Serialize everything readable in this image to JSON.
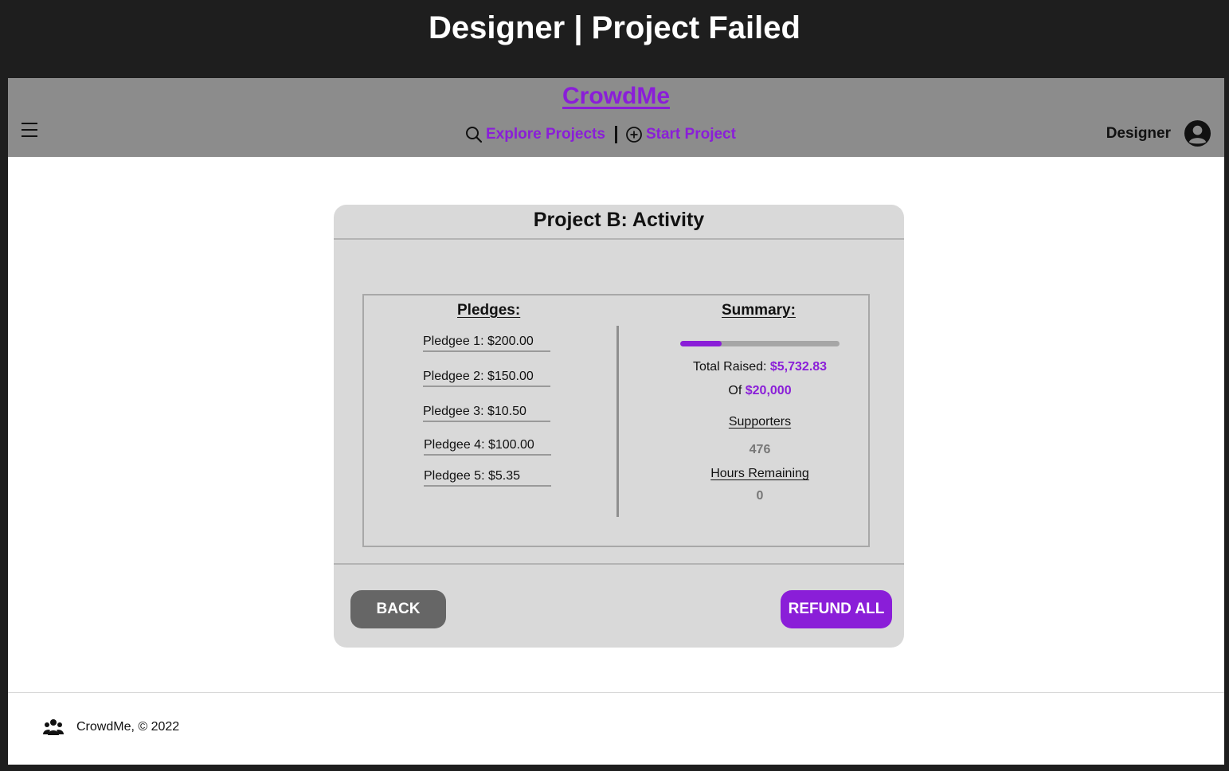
{
  "frame": {
    "title": "Designer | Project Failed"
  },
  "navbar": {
    "brand": "CrowdMe",
    "links": [
      {
        "label": "Explore Projects",
        "icon": "search-icon"
      },
      {
        "label": "Start Project",
        "icon": "plus-circle-icon"
      }
    ],
    "user": {
      "name": "Designer",
      "icon": "user-avatar-icon"
    },
    "menu_icon": "hamburger-menu-icon"
  },
  "card": {
    "title": "Project B: Activity",
    "pledges": {
      "title": "Pledges:",
      "items": [
        "Pledgee 1: $200.00",
        "Pledgee 2: $150.00",
        "Pledgee 3: $10.50",
        "Pledgee 4: $100.00",
        "Pledgee 5: $5.35"
      ]
    },
    "summary": {
      "title": "Summary:",
      "progress_fraction": 0.26,
      "total_raised_label": "Total Raised: ",
      "total_raised_value": "$5,732.83",
      "goal_label": "Of ",
      "goal_value": "$20,000",
      "supporters_label": "Supporters",
      "supporters_value": "476",
      "hours_label": "Hours Remaining",
      "hours_value": "0"
    },
    "buttons": {
      "back": "BACK",
      "refund": "REFUND ALL"
    }
  },
  "footer": {
    "text": "CrowdMe, © 2022",
    "icon": "users-group-icon"
  },
  "colors": {
    "accent": "#8a1ed8",
    "navbar": "#8c8c8c",
    "card": "#d9d9d9",
    "back_button": "#666666"
  }
}
